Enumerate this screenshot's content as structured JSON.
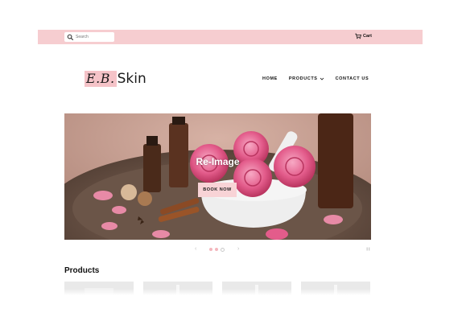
{
  "topbar": {
    "search_placeholder": "Search",
    "cart_label": "Cart"
  },
  "brand": {
    "monogram": "E.B.",
    "name": "Skin"
  },
  "nav": {
    "items": [
      {
        "label": "HOME"
      },
      {
        "label": "PRODUCTS",
        "has_dropdown": true
      },
      {
        "label": "CONTACT US"
      }
    ]
  },
  "hero": {
    "title": "Re-Image",
    "button_label": "BOOK NOW"
  },
  "slider": {
    "prev_icon": "chevron-left-icon",
    "next_icon": "chevron-right-icon",
    "slide_count": 3,
    "active_index": 0
  },
  "products_section": {
    "title": "Products",
    "visible_cards": 4
  },
  "colors": {
    "accent_pink": "#f6cdd0",
    "button_pink": "#f8d3d6",
    "text": "#111111"
  }
}
